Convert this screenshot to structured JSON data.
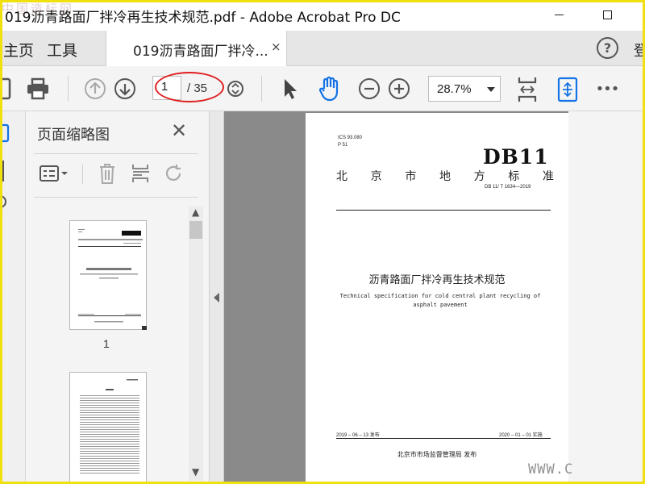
{
  "window": {
    "title": "019沥青路面厂拌冷再生技术规范.pdf - Adobe Acrobat Pro DC",
    "watermark_top": "中国造标网",
    "watermark_bottom": "WWW.C"
  },
  "tabs": {
    "home": "主页",
    "tools": "工具",
    "document": "019沥青路面厂拌冷...",
    "close_glyph": "×",
    "help_glyph": "?",
    "login_cut": "登"
  },
  "toolbar": {
    "current_page": "1",
    "total_pages": "/ 35",
    "zoom": "28.7%",
    "more_glyph": "•••",
    "icons": [
      "save-icon",
      "print-icon",
      "page-up-icon",
      "page-down-icon",
      "select-cursor-icon",
      "hand-tool-icon",
      "zoom-out-icon",
      "zoom-in-icon",
      "fit-page-icon",
      "scroll-mode-icon",
      "more-icon"
    ],
    "accent": "#1473e6",
    "annotation_color": "#e02020"
  },
  "thumbnails_panel": {
    "title": "页面缩略图",
    "close_glyph": "✕",
    "items": [
      {
        "page_label": "1"
      }
    ]
  },
  "document": {
    "ics": "ICS 93.080",
    "ccs": "P 51",
    "db_code": "DB11",
    "region_chars": [
      "北",
      "京",
      "市",
      "地",
      "方",
      "标",
      "准"
    ],
    "standard_number": "DB 11/ T 1634—2019",
    "title_cn": "沥青路面厂拌冷再生技术规范",
    "title_en": "Technical specification for cold central plant recycling of asphalt pavement",
    "issue_date": "2019 – 06 – 13 发布",
    "effective_date": "2020 – 01 – 01 实施",
    "issuer": "北京市市场监督管理局 发布"
  }
}
